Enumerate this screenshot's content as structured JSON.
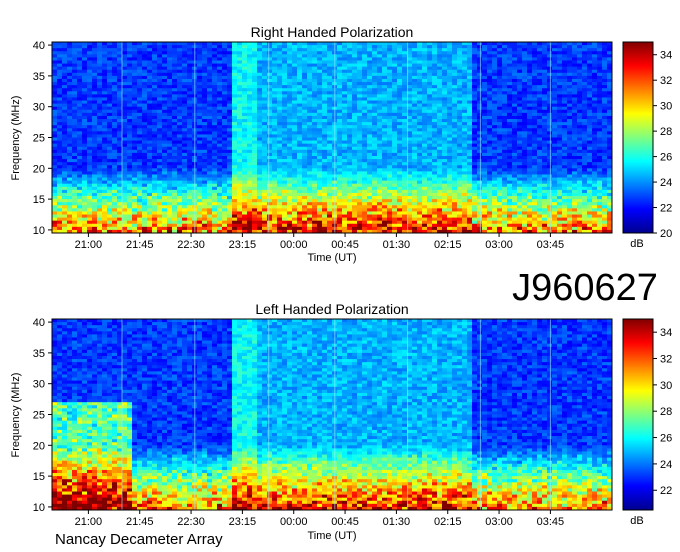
{
  "footer": "Nancay Decameter Array",
  "observation_id": "J960627",
  "chart_data": [
    {
      "type": "heatmap",
      "title": "Right Handed Polarization",
      "xlabel": "Time (UT)",
      "ylabel": "Frequency (MHz)",
      "x_ticks": [
        "21:00",
        "21:45",
        "22:30",
        "23:15",
        "00:00",
        "00:45",
        "01:30",
        "02:15",
        "03:00",
        "03:45"
      ],
      "y_ticks": [
        10,
        15,
        20,
        25,
        30,
        35,
        40
      ],
      "ylim": [
        9.5,
        40.5
      ],
      "colorbar": {
        "label": "dB",
        "ticks": [
          20,
          22,
          24,
          26,
          28,
          30,
          32,
          34
        ],
        "range": [
          20,
          35
        ]
      }
    },
    {
      "type": "heatmap",
      "title": "Left Handed Polarization",
      "xlabel": "Time (UT)",
      "ylabel": "Frequency (MHz)",
      "x_ticks": [
        "21:00",
        "21:45",
        "22:30",
        "23:15",
        "00:00",
        "00:45",
        "01:30",
        "02:15",
        "03:00",
        "03:45"
      ],
      "y_ticks": [
        10,
        15,
        20,
        25,
        30,
        35,
        40
      ],
      "ylim": [
        9.5,
        40.5
      ],
      "colorbar": {
        "label": "dB",
        "ticks": [
          22,
          24,
          26,
          28,
          30,
          32,
          34
        ],
        "range": [
          20.5,
          35
        ]
      }
    }
  ]
}
